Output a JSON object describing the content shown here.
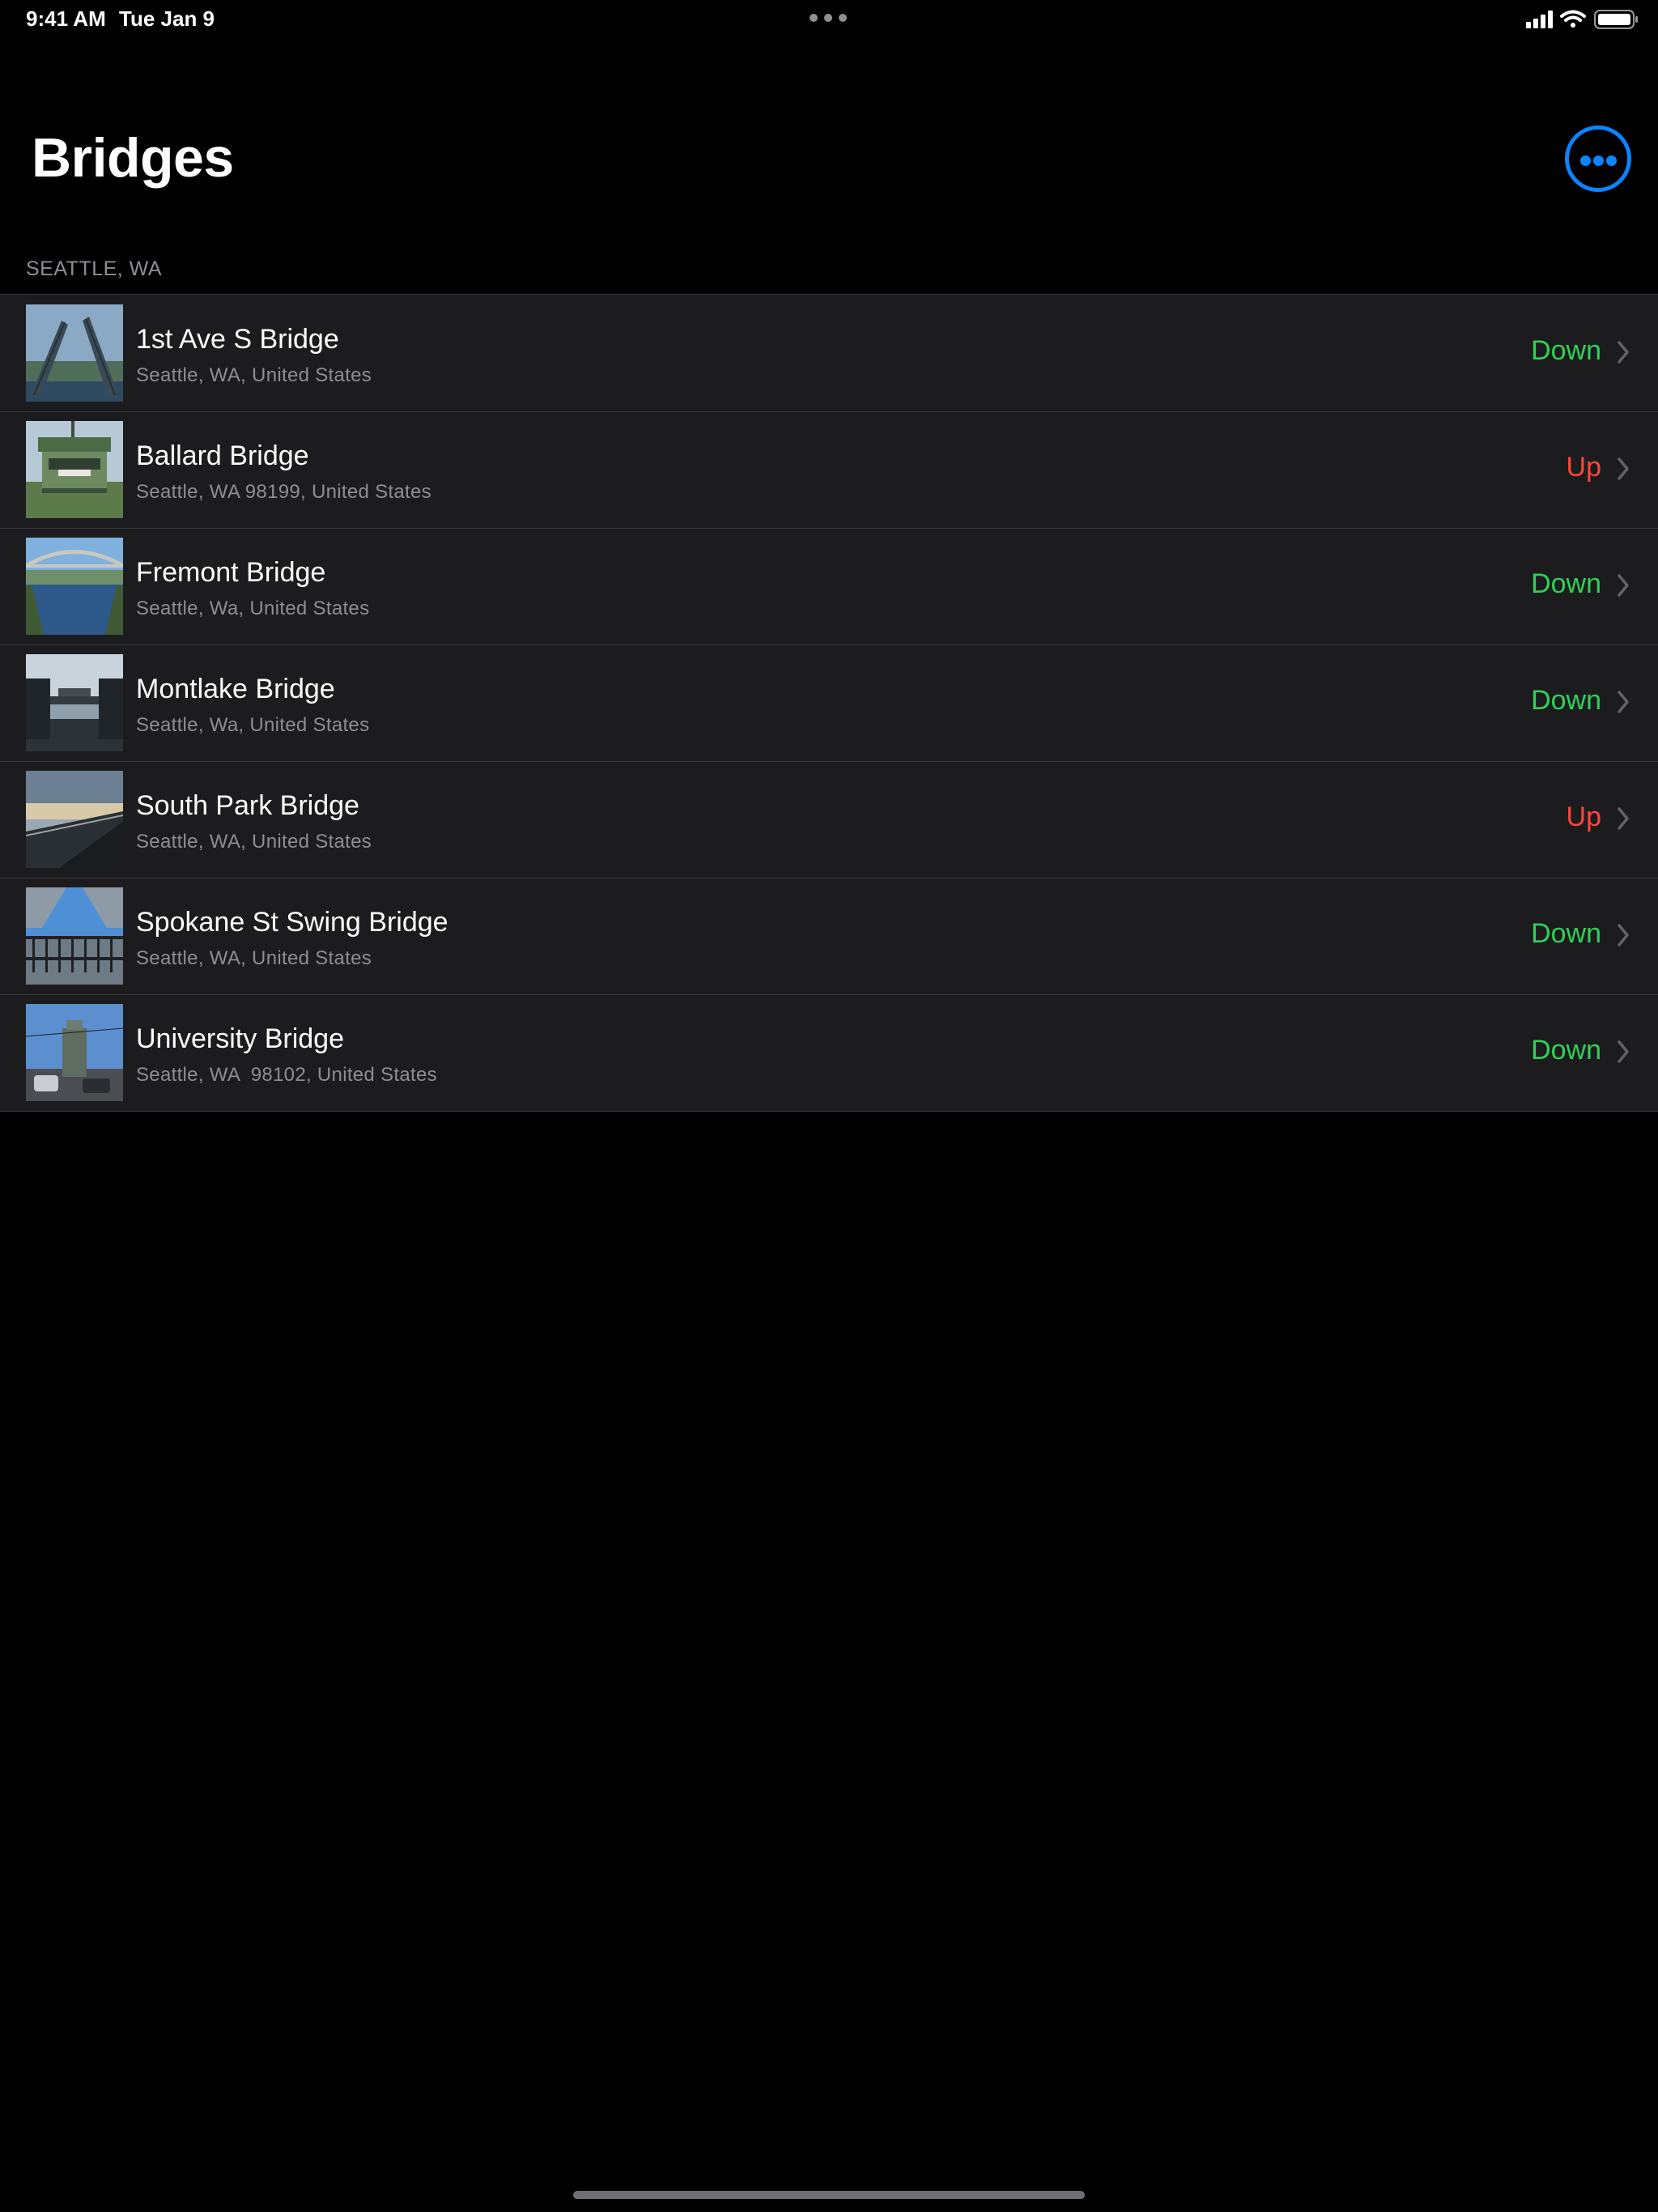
{
  "status_bar": {
    "time": "9:41 AM",
    "date": "Tue Jan 9"
  },
  "nav": {
    "title": "Bridges",
    "more_button_icon": "ellipsis-circle-icon"
  },
  "section": {
    "header": "SEATTLE, WA"
  },
  "bridges": [
    {
      "name": "1st Ave S Bridge",
      "address": "Seattle, WA, United States",
      "status": "Down"
    },
    {
      "name": "Ballard Bridge",
      "address": "Seattle, WA 98199, United States",
      "status": "Up"
    },
    {
      "name": "Fremont Bridge",
      "address": "Seattle, Wa, United States",
      "status": "Down"
    },
    {
      "name": "Montlake Bridge",
      "address": "Seattle, Wa, United States",
      "status": "Down"
    },
    {
      "name": "South Park Bridge",
      "address": "Seattle, WA, United States",
      "status": "Up"
    },
    {
      "name": "Spokane St Swing Bridge",
      "address": "Seattle, WA, United States",
      "status": "Down"
    },
    {
      "name": "University Bridge",
      "address": "Seattle, WA  98102, United States",
      "status": "Down"
    }
  ],
  "colors": {
    "accent": "#0a84ff",
    "status_down": "#30d158",
    "status_up": "#ff453a",
    "row_background": "#1c1c1e",
    "secondary_text": "#8d8d93"
  }
}
